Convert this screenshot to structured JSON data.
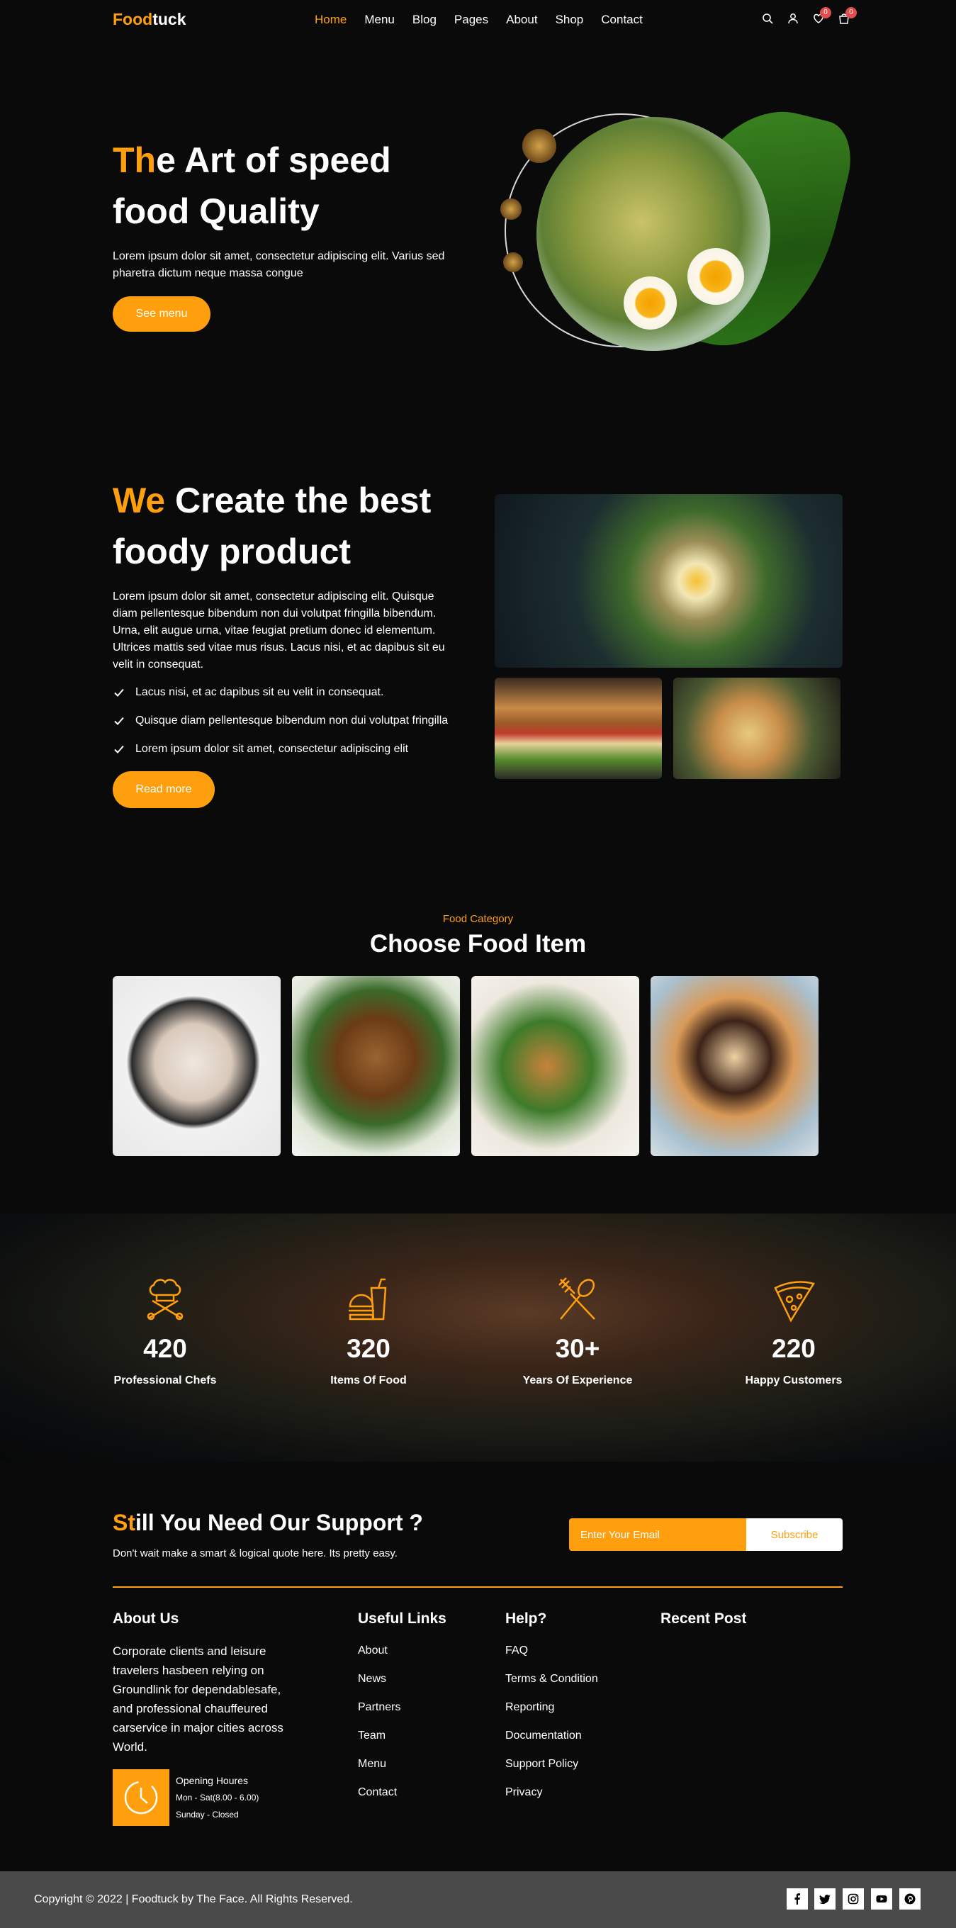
{
  "header": {
    "logo_part1": "Food",
    "logo_part2": "tuck",
    "nav": [
      "Home",
      "Menu",
      "Blog",
      "Pages",
      "About",
      "Shop",
      "Contact"
    ],
    "wishlist_count": "0",
    "cart_count": "0"
  },
  "hero": {
    "title_accent": "Th",
    "title_rest": "e Art of speed food Quality",
    "text": "Lorem ipsum dolor sit amet, consectetur adipiscing elit. Varius sed pharetra dictum neque massa congue",
    "button": "See menu"
  },
  "about": {
    "title_accent": "We",
    "title_rest": " Create the best foody product",
    "text": "Lorem ipsum dolor sit amet, consectetur adipiscing elit. Quisque diam pellentesque bibendum non dui volutpat fringilla bibendum. Urna, elit augue urna, vitae feugiat pretium donec id elementum. Ultrices mattis sed vitae mus risus. Lacus nisi, et ac dapibus sit eu velit in consequat.",
    "checks": [
      "Lacus nisi, et ac dapibus sit eu velit in consequat.",
      "Quisque diam pellentesque bibendum non dui volutpat fringilla",
      "Lorem ipsum dolor sit amet, consectetur adipiscing elit"
    ],
    "button": "Read more"
  },
  "category": {
    "subtitle": "Food Category",
    "title": "Choose Food Item"
  },
  "stats": [
    {
      "icon": "chef-hat-icon",
      "value": "420",
      "label": "Professional Chefs"
    },
    {
      "icon": "burger-drink-icon",
      "value": "320",
      "label": "Items Of Food"
    },
    {
      "icon": "fork-spoon-icon",
      "value": "30+",
      "label": "Years Of Experience"
    },
    {
      "icon": "pizza-slice-icon",
      "value": "220",
      "label": "Happy Customers"
    }
  ],
  "support": {
    "title_accent": "St",
    "title_rest": "ill You Need Our Support ?",
    "text": "Don't wait make a smart & logical quote here. Its pretty easy.",
    "email_placeholder": "Enter Your Email",
    "subscribe": "Subscribe"
  },
  "footer": {
    "about_title": "About Us",
    "about_text": "Corporate clients and leisure travelers hasbeen relying on Groundlink for dependablesafe, and professional chauffeured carservice in major cities across World.",
    "hours_title": "Opening Houres",
    "hours_week": "Mon - Sat(8.00 - 6.00)",
    "hours_sun": "Sunday - Closed",
    "useful_title": "Useful Links",
    "useful_links": [
      "About",
      "News",
      "Partners",
      "Team",
      "Menu",
      "Contact"
    ],
    "help_title": "Help?",
    "help_links": [
      "FAQ",
      "Terms & Condition",
      "Reporting",
      "Documentation",
      "Support Policy",
      "Privacy"
    ],
    "recent_title": "Recent Post",
    "copyright": "Copyright © 2022 | Foodtuck by The Face. All Rights Reserved.",
    "social": [
      "facebook-icon",
      "twitter-icon",
      "instagram-icon",
      "youtube-icon",
      "pinterest-icon"
    ]
  },
  "colors": {
    "accent": "#ff9f0d",
    "background": "#0a0a0a",
    "bottom_bar": "#4a4a4a"
  }
}
